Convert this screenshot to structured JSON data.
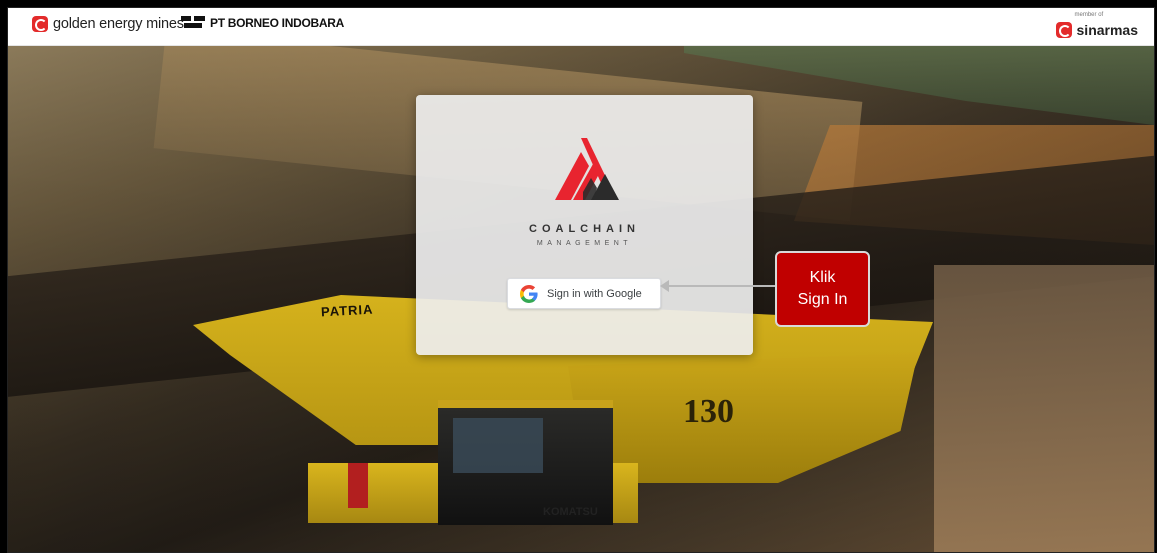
{
  "header": {
    "left_brand": "golden energy mines",
    "second_brand": "PT BORNEO INDOBARA",
    "right_brand_small": "member of",
    "right_brand": "sinarmas"
  },
  "background": {
    "truck_brand": "PATRIA",
    "truck_number": "130",
    "truck_maker": "KOMATSU"
  },
  "login": {
    "app_name": "COALCHAIN",
    "app_subtitle": "MANAGEMENT",
    "google_button_label": "Sign in with Google"
  },
  "callout": {
    "line1": "Klik",
    "line2": "Sign In",
    "color": "#c00000"
  },
  "icons": [
    "gem-logo-icon",
    "borneo-logo-icon",
    "sinarmas-logo-icon",
    "coalchain-logo-icon",
    "google-g-icon"
  ]
}
